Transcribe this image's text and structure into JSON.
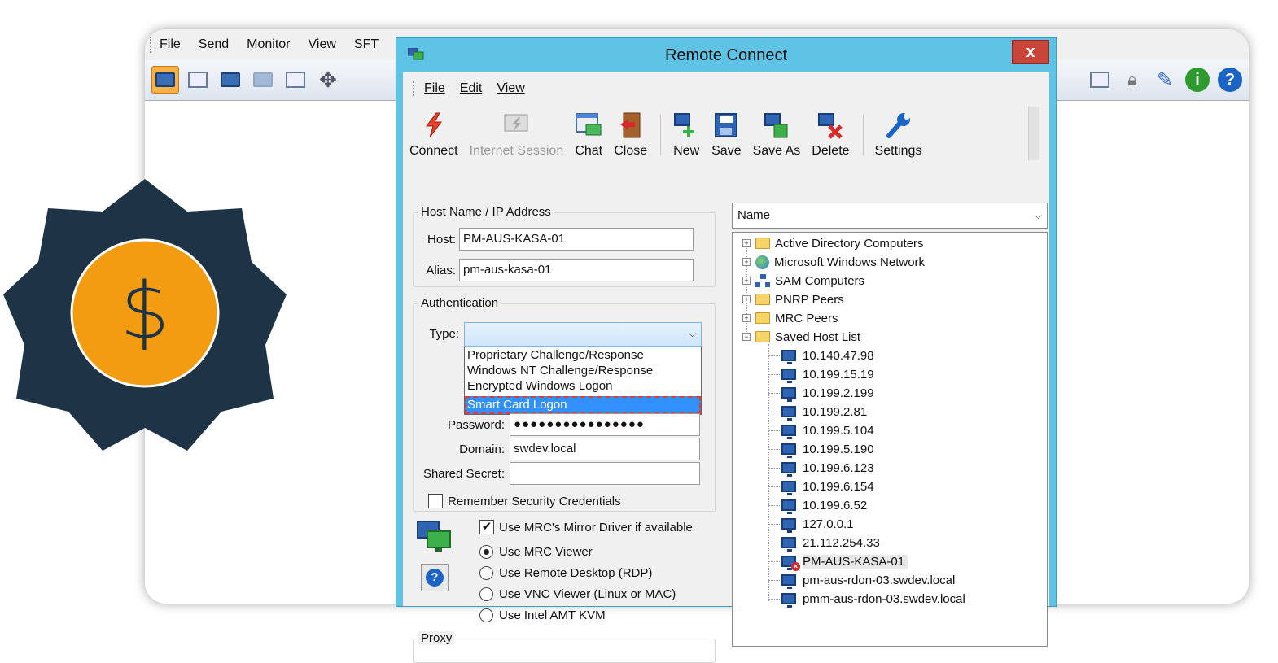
{
  "background_app": {
    "menu": [
      "File",
      "Send",
      "Monitor",
      "View",
      "SFT"
    ],
    "icons_left": [
      "remote-control-icon",
      "chat-window-icon",
      "transfer-icon",
      "monitor-disabled-icon",
      "screen-icon",
      "move-icon"
    ],
    "icons_right": [
      "windows-icon",
      "lock-icon",
      "edit-icon",
      "info-icon",
      "help-icon"
    ]
  },
  "badge": {
    "symbol": "$",
    "colors": {
      "star": "#1e3446",
      "coin": "#f39c12"
    }
  },
  "dialog": {
    "title": "Remote Connect",
    "close_label": "x",
    "menu": [
      "File",
      "Edit",
      "View"
    ],
    "toolbar": {
      "connect": "Connect",
      "internet_session": "Internet Session",
      "chat": "Chat",
      "close": "Close",
      "new": "New",
      "save": "Save",
      "save_as": "Save As",
      "delete": "Delete",
      "settings": "Settings"
    },
    "host_group": {
      "title": "Host Name / IP Address",
      "host_label": "Host:",
      "host_value": "PM-AUS-KASA-01",
      "alias_label": "Alias:",
      "alias_value": "pm-aus-kasa-01"
    },
    "auth_group": {
      "title": "Authentication",
      "type_label": "Type:",
      "type_value": "",
      "options": [
        "Proprietary Challenge/Response",
        "Windows NT Challenge/Response",
        "Encrypted Windows Logon",
        "Smart Card Logon"
      ],
      "selected_option": "Smart Card Logon",
      "password_label": "Password:",
      "password_value": "●●●●●●●●●●●●●●●●",
      "domain_label": "Domain:",
      "domain_value": "swdev.local",
      "secret_label": "Shared Secret:",
      "secret_value": "",
      "remember_label": "Remember Security Credentials",
      "remember_checked": false
    },
    "viewer": {
      "mirror_label": "Use MRC's Mirror Driver if available",
      "mirror_checked": true,
      "help_label": "?",
      "options": [
        "Use MRC Viewer",
        "Use Remote Desktop (RDP)",
        "Use VNC Viewer (Linux or MAC)",
        "Use Intel AMT KVM"
      ],
      "selected": "Use MRC Viewer"
    },
    "proxy_title": "Proxy",
    "tree": {
      "sort_label": "Name",
      "groups": [
        {
          "label": "Active Directory Computers",
          "expanded": false
        },
        {
          "label": "Microsoft Windows Network",
          "expanded": false
        },
        {
          "label": "SAM Computers",
          "expanded": false
        },
        {
          "label": "PNRP Peers",
          "expanded": false
        },
        {
          "label": "MRC Peers",
          "expanded": false
        },
        {
          "label": "Saved Host List",
          "expanded": true
        }
      ],
      "hosts": [
        "10.140.47.98",
        "10.199.15.19",
        "10.199.2.199",
        "10.199.2.81",
        "10.199.5.104",
        "10.199.5.190",
        "10.199.6.123",
        "10.199.6.154",
        "10.199.6.52",
        "127.0.0.1",
        "21.112.254.33",
        "PM-AUS-KASA-01",
        "pm-aus-rdon-03.swdev.local",
        "pmm-aus-rdon-03.swdev.local"
      ],
      "selected_host": "PM-AUS-KASA-01"
    }
  }
}
